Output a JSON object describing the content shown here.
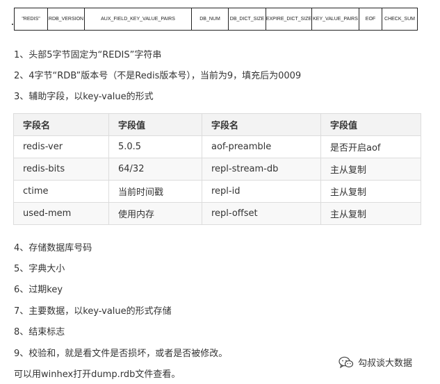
{
  "format_bar": {
    "cells": [
      "\"REDIS\"",
      "RDB_VERSION",
      "AUX_FIELD_KEY_VALUE_PAIRS",
      "DB_NUM",
      "DB_DICT_SIZE",
      "EXPIRE_DICT_SIZE",
      "KEY_VALUE_PAIRS",
      "EOF",
      "CHECK_SUM"
    ]
  },
  "intro_lines": [
    "1、头部5字节固定为“REDIS”字符串",
    "2、4字节“RDB”版本号（不是Redis版本号），当前为9，填充后为0009",
    "3、辅助字段，以key-value的形式"
  ],
  "aux_table": {
    "headers": [
      "字段名",
      "字段值",
      "字段名",
      "字段值"
    ],
    "rows": [
      [
        "redis-ver",
        "5.0.5",
        "aof-preamble",
        "是否开启aof"
      ],
      [
        "redis-bits",
        "64/32",
        "repl-stream-db",
        "主从复制"
      ],
      [
        "ctime",
        "当前时间戳",
        "repl-id",
        "主从复制"
      ],
      [
        "used-mem",
        "使用内存",
        "repl-offset",
        "主从复制"
      ]
    ]
  },
  "after_lines": [
    "4、存储数据库号码",
    "5、字典大小",
    "6、过期key",
    "7、主要数据，以key-value的形式存储",
    "8、结束标志",
    "9、校验和，就是看文件是否损坏，或者是否被修改。",
    "可以用winhex打开dump.rdb文件查看。"
  ],
  "watermark": {
    "text": "勾叔谈大数据",
    "icon": "wechat-icon"
  }
}
